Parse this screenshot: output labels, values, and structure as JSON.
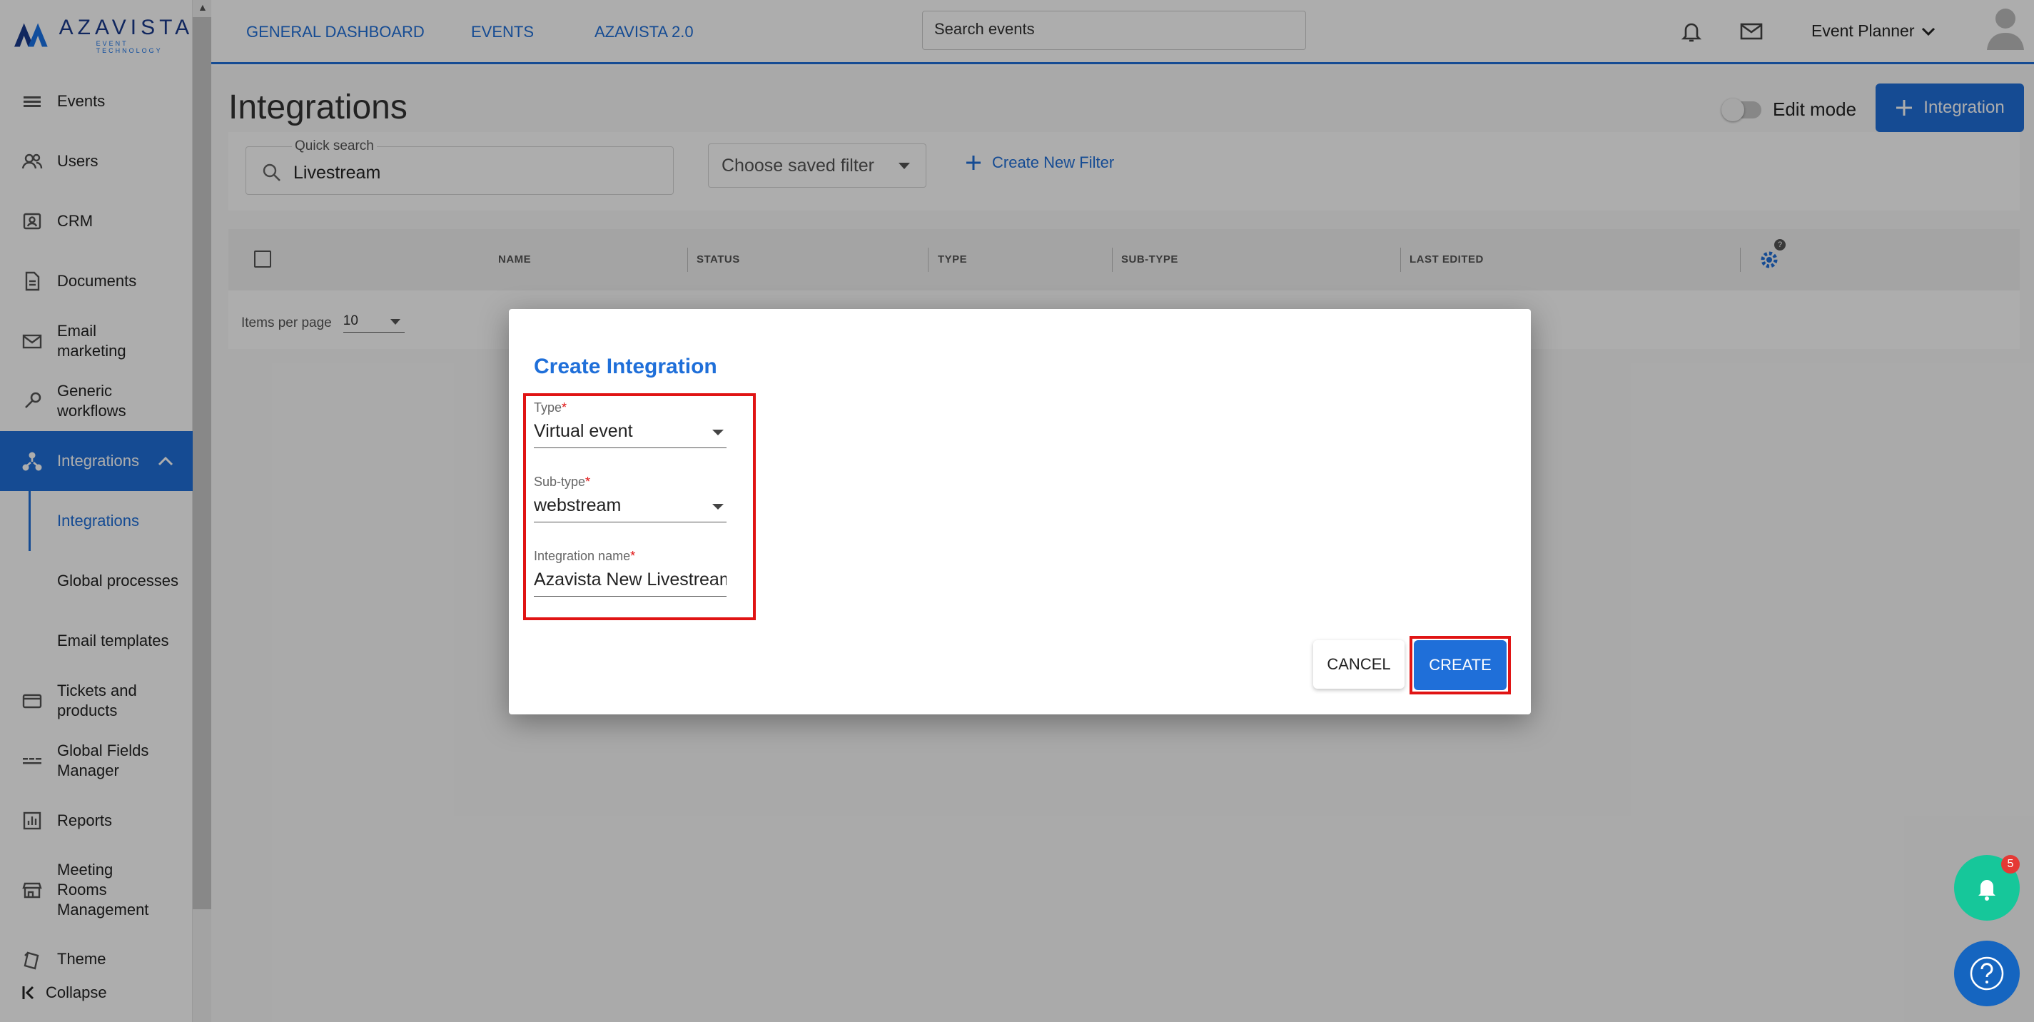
{
  "brand": {
    "name": "AZAVISTA",
    "tagline": "EVENT TECHNOLOGY"
  },
  "sidebar": {
    "items": [
      {
        "label": "Events",
        "icon": "events-icon"
      },
      {
        "label": "Users",
        "icon": "users-icon"
      },
      {
        "label": "CRM",
        "icon": "crm-icon"
      },
      {
        "label": "Documents",
        "icon": "document-icon"
      },
      {
        "label": "Email marketing",
        "icon": "email-icon"
      },
      {
        "label": "Generic workflows",
        "icon": "wrench-icon"
      },
      {
        "label": "Integrations",
        "icon": "integrations-icon",
        "active": true,
        "expanded": true
      },
      {
        "label": "Tickets and products",
        "icon": "ticket-icon"
      },
      {
        "label": "Global Fields Manager",
        "icon": "fields-icon"
      },
      {
        "label": "Reports",
        "icon": "reports-icon"
      },
      {
        "label": "Meeting Rooms Management",
        "icon": "store-icon"
      },
      {
        "label": "Theme",
        "icon": "theme-icon"
      }
    ],
    "sub_items": [
      {
        "label": "Integrations",
        "current": true
      },
      {
        "label": "Global processes"
      },
      {
        "label": "Email templates"
      }
    ],
    "collapse_label": "Collapse"
  },
  "topbar": {
    "links": [
      "GENERAL DASHBOARD",
      "EVENTS",
      "AZAVISTA 2.0"
    ],
    "search_placeholder": "Search events",
    "user_role": "Event Planner"
  },
  "main": {
    "title": "Integrations",
    "edit_mode_label": "Edit mode",
    "add_button_label": "Integration",
    "quick_search_label": "Quick search",
    "quick_search_value": "Livestream",
    "saved_filter_placeholder": "Choose saved filter",
    "create_filter_label": "Create New Filter",
    "table": {
      "columns": [
        "NAME",
        "STATUS",
        "TYPE",
        "SUB-TYPE",
        "LAST EDITED"
      ],
      "settings_help": "?",
      "items_per_page_label": "Items per page",
      "items_per_page_value": "10"
    }
  },
  "modal": {
    "title": "Create Integration",
    "fields": [
      {
        "label": "Type",
        "value": "Virtual event",
        "required": "*"
      },
      {
        "label": "Sub-type",
        "value": "webstream",
        "required": "*"
      },
      {
        "label": "Integration name",
        "value": "Azavista New Livestream",
        "required": "*"
      }
    ],
    "cancel_label": "CANCEL",
    "create_label": "CREATE"
  },
  "fab": {
    "notification_count": "5"
  },
  "colors": {
    "primary": "#1f6fd9",
    "highlight": "#e01414",
    "notify": "#16c79a",
    "help": "#1565c0"
  }
}
